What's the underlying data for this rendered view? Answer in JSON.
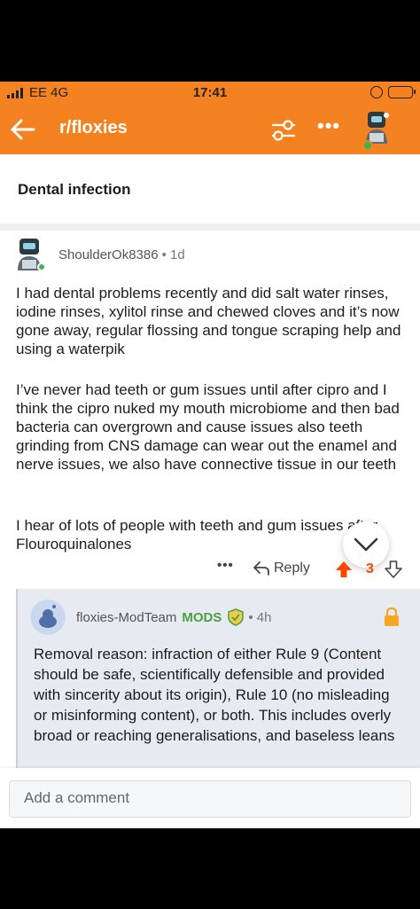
{
  "status_bar": {
    "carrier": "EE  4G",
    "time": "17:41"
  },
  "header": {
    "subreddit": "r/floxies",
    "more_label": "•••"
  },
  "post": {
    "title": "Dental infection"
  },
  "comment": {
    "author": "ShoulderOk8386",
    "age": "• 1d",
    "paragraphs": [
      "I had dental problems recently and did salt water rinses, iodine rinses, xylitol rinse and chewed cloves and it’s now gone away, regular flossing and tongue scraping help and using a waterpik",
      "I’ve never had teeth or gum issues until after cipro and I think the cipro nuked my mouth microbiome and then bad bacteria can overgrown and cause issues also teeth grinding from CNS damage can wear out the enamel and nerve issues, we also have connective tissue in our teeth",
      "I hear of lots of people with teeth and gum issues after Flouroquinalones"
    ],
    "actions": {
      "more": "•••",
      "reply": "Reply",
      "votes": "3"
    }
  },
  "mod_reply": {
    "author": "floxies-ModTeam",
    "badge": "MODS",
    "age": "• 4h",
    "text": "Removal reason: infraction of either Rule 9 (Content should be safe, scientifically defensible and provided with sincerity about its origin), Rule 10 (no misleading or misinforming content), or both.  This includes overly broad or reaching generalisations, and baseless leans"
  },
  "composer": {
    "placeholder": "Add a comment"
  },
  "colors": {
    "accent": "#f58220",
    "upvote": "#ff4500",
    "mod_green": "#46a240",
    "lock": "#f5a623"
  }
}
